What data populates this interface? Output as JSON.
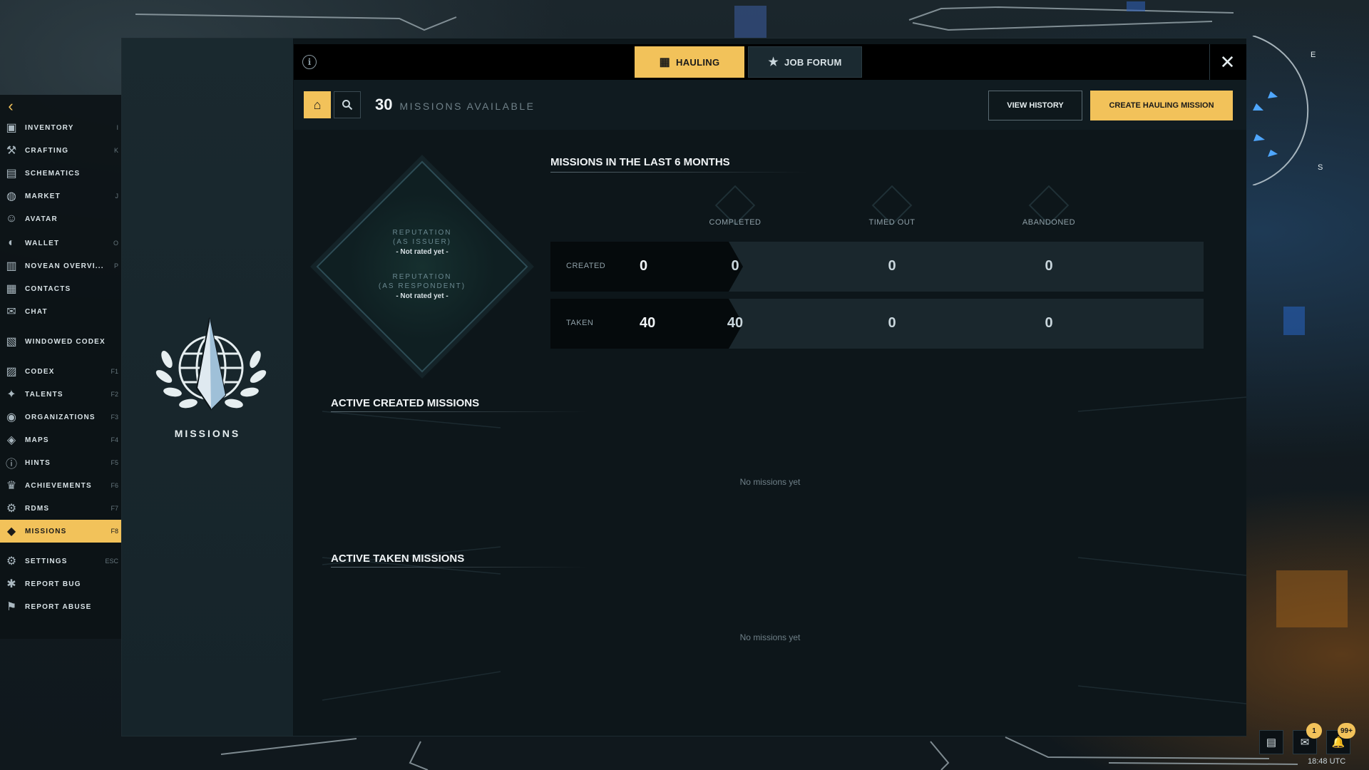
{
  "nav": {
    "items": [
      {
        "label": "Inventory",
        "key": "I",
        "icon": "inventory-icon"
      },
      {
        "label": "Crafting",
        "key": "K",
        "icon": "crafting-icon"
      },
      {
        "label": "Schematics",
        "key": "",
        "icon": "schematics-icon"
      },
      {
        "label": "Market",
        "key": "J",
        "icon": "market-icon"
      },
      {
        "label": "Avatar",
        "key": "",
        "icon": "avatar-icon"
      },
      {
        "label": "Wallet",
        "key": "O",
        "icon": "wallet-icon"
      },
      {
        "label": "Novean overvi...",
        "key": "P",
        "icon": "novean-overview-icon"
      },
      {
        "label": "Contacts",
        "key": "",
        "icon": "contacts-icon"
      },
      {
        "label": "Chat",
        "key": "",
        "icon": "chat-icon"
      },
      {
        "label": "Windowed codex",
        "key": "",
        "icon": "windowed-codex-icon"
      },
      {
        "label": "Codex",
        "key": "F1",
        "icon": "codex-icon"
      },
      {
        "label": "Talents",
        "key": "F2",
        "icon": "talents-icon"
      },
      {
        "label": "Organizations",
        "key": "F3",
        "icon": "organizations-icon"
      },
      {
        "label": "Maps",
        "key": "F4",
        "icon": "maps-icon"
      },
      {
        "label": "Hints",
        "key": "F5",
        "icon": "hints-icon"
      },
      {
        "label": "Achievements",
        "key": "F6",
        "icon": "achievements-icon"
      },
      {
        "label": "RDMS",
        "key": "F7",
        "icon": "rdms-icon"
      },
      {
        "label": "Missions",
        "key": "F8",
        "icon": "missions-icon",
        "active": true
      },
      {
        "label": "Settings",
        "key": "ESC",
        "icon": "settings-icon"
      },
      {
        "label": "Report bug",
        "key": "",
        "icon": "report-bug-icon"
      },
      {
        "label": "Report abuse",
        "key": "",
        "icon": "report-abuse-icon"
      }
    ]
  },
  "sidebar": {
    "title": "MISSIONS"
  },
  "tabs": {
    "hauling": "HAULING",
    "job_forum": "JOB FORUM"
  },
  "toolbar": {
    "missions_count": "30",
    "missions_label": "MISSIONS AVAILABLE",
    "view_history": "VIEW HISTORY",
    "create_hauling": "CREATE HAULING MISSION"
  },
  "reputation": {
    "issuer_label_1": "REPUTATION",
    "issuer_label_2": "(AS ISSUER)",
    "issuer_value": "- Not rated yet -",
    "respondent_label_1": "REPUTATION",
    "respondent_label_2": "(AS RESPONDENT)",
    "respondent_value": "- Not rated yet -"
  },
  "stats": {
    "title": "MISSIONS IN THE LAST 6 MONTHS",
    "columns": [
      "COMPLETED",
      "TIMED OUT",
      "ABANDONED"
    ],
    "rows": [
      {
        "label": "CREATED",
        "total": "0",
        "completed": "0",
        "timed_out": "0",
        "abandoned": "0"
      },
      {
        "label": "TAKEN",
        "total": "40",
        "completed": "40",
        "timed_out": "0",
        "abandoned": "0"
      }
    ]
  },
  "active_created": {
    "title": "ACTIVE CREATED MISSIONS",
    "empty": "No missions yet"
  },
  "active_taken": {
    "title": "ACTIVE TAKEN MISSIONS",
    "empty": "No missions yet"
  },
  "tray": {
    "chat_badge": "1",
    "notif_badge": "99+",
    "clock": "18:48 UTC"
  },
  "compass": {
    "east": "E",
    "south": "S"
  },
  "colors": {
    "accent": "#f2c25a",
    "panel": "#0d161a"
  }
}
